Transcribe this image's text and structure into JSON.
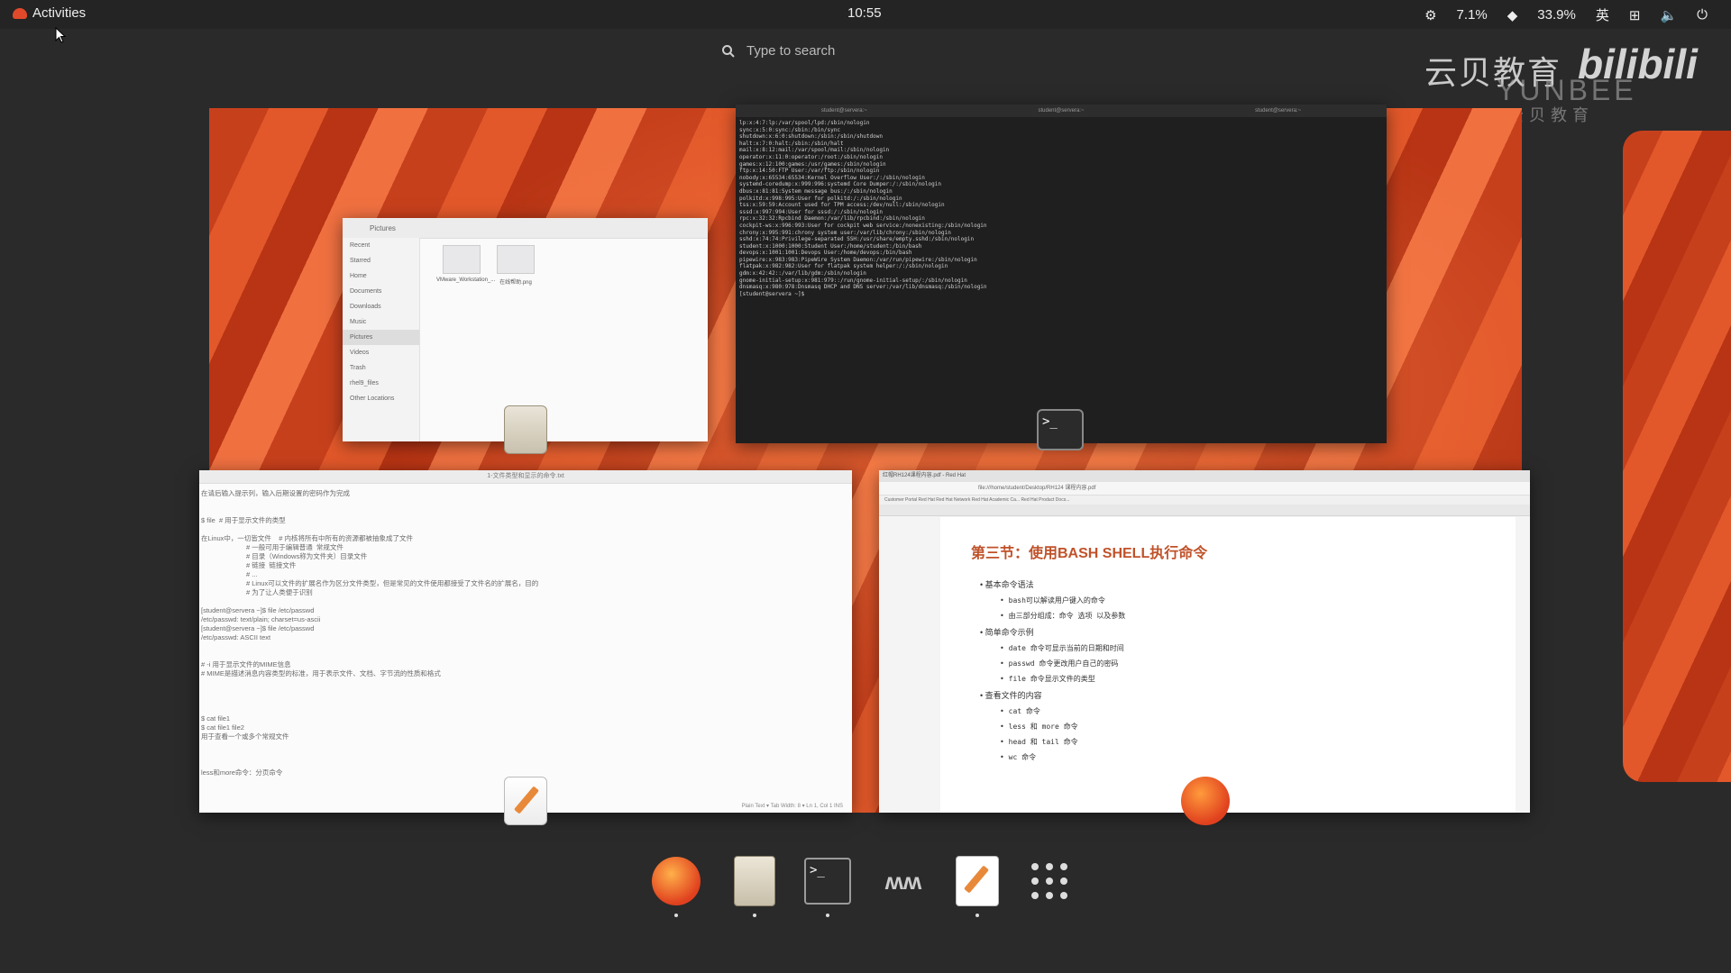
{
  "topbar": {
    "activities": "Activities",
    "clock": "10:55",
    "cpu": "7.1%",
    "mem": "33.9%",
    "input_method": "英"
  },
  "search": {
    "placeholder": "Type to search"
  },
  "watermark": {
    "cn": "云贝教育",
    "en": "YUNBEE",
    "logo": "bilibili",
    "cn2": "云贝教育"
  },
  "files_window": {
    "header": "Pictures",
    "sidebar": [
      "Recent",
      "Starred",
      "Home",
      "Documents",
      "Downloads",
      "Music",
      "Pictures",
      "Videos",
      "Trash",
      "rhel9_files",
      "Other Locations"
    ],
    "items": [
      "VMware_Workstation_...",
      "在线帮助.png"
    ]
  },
  "terminal_window": {
    "tabs": [
      "student@servera:~",
      "student@servera:~",
      "student@servera:~"
    ],
    "lines": [
      "lp:x:4:7:lp:/var/spool/lpd:/sbin/nologin",
      "sync:x:5:0:sync:/sbin:/bin/sync",
      "shutdown:x:6:0:shutdown:/sbin:/sbin/shutdown",
      "halt:x:7:0:halt:/sbin:/sbin/halt",
      "mail:x:8:12:mail:/var/spool/mail:/sbin/nologin",
      "operator:x:11:0:operator:/root:/sbin/nologin",
      "games:x:12:100:games:/usr/games:/sbin/nologin",
      "ftp:x:14:50:FTP User:/var/ftp:/sbin/nologin",
      "nobody:x:65534:65534:Kernel Overflow User:/:/sbin/nologin",
      "systemd-coredump:x:999:996:systemd Core Dumper:/:/sbin/nologin",
      "dbus:x:81:81:System message bus:/:/sbin/nologin",
      "polkitd:x:998:995:User for polkitd:/:/sbin/nologin",
      "tss:x:59:59:Account used for TPM access:/dev/null:/sbin/nologin",
      "sssd:x:997:994:User for sssd:/:/sbin/nologin",
      "rpc:x:32:32:Rpcbind Daemon:/var/lib/rpcbind:/sbin/nologin",
      "cockpit-ws:x:996:993:User for cockpit web service:/nonexisting:/sbin/nologin",
      "chrony:x:995:991:chrony system user:/var/lib/chrony:/sbin/nologin",
      "sshd:x:74:74:Privilege-separated SSH:/usr/share/empty.sshd:/sbin/nologin",
      "student:x:1000:1000:Student User:/home/student:/bin/bash",
      "devops:x:1001:1001:Devops User:/home/devops:/bin/bash",
      "pipewire:x:983:983:PipeWire System Daemon:/var/run/pipewire:/sbin/nologin",
      "flatpak:x:982:982:User for flatpak system helper:/:/sbin/nologin",
      "gdm:x:42:42::/var/lib/gdm:/sbin/nologin",
      "gnome-initial-setup:x:981:979::/run/gnome-initial-setup/:/sbin/nologin",
      "dnsmasq:x:980:978:Dnsmasq DHCP and DNS server:/var/lib/dnsmasq:/sbin/nologin",
      "[student@servera ~]$ "
    ]
  },
  "editor_window": {
    "title": "1-文件类型和显示的命令.txt",
    "lines": [
      "在请后输入提示列，输入后期设置的密码作为完成",
      "",
      "",
      "$ file  # 用于显示文件的类型",
      "",
      "在Linux中，一切皆文件    # 内核将所有中所有的资源都被抽象成了文件",
      "                        # 一般可用于编辑普通  常规文件",
      "                        # 目录（Windows称为文件夹）目录文件",
      "                        # 链接  链接文件",
      "                        # ...",
      "                        # Linux可以文件的扩展名作为区分文件类型，但是常见的文件使用都接受了文件名的扩展名，目的",
      "                        # 为了让人类便于识别",
      "",
      "[student@servera ~]$ file /etc/passwd",
      "/etc/passwd: text/plain; charset=us-ascii",
      "[student@servera ~]$ file /etc/passwd",
      "/etc/passwd: ASCII text",
      "",
      "",
      "# -i 用于显示文件的MIME信息",
      "# MIME是描述消息内容类型的标准，用于表示文件、文档、字节流的性质和格式",
      "",
      "",
      "",
      "",
      "$ cat file1",
      "$ cat file1 file2",
      "用于查看一个或多个常规文件",
      "",
      "",
      "",
      "less和more命令：分页命令"
    ],
    "status": "Plain Text ▾   Tab Width: 8 ▾   Ln 1, Col 1   INS"
  },
  "browser_window": {
    "tabs": "红帽RH124课程内容.pdf - Red Hat",
    "url": "file:///home/student/Desktop/RH124 课程内容.pdf",
    "bookmarks": "Customer Portal   Red Hat   Red Hat Network   Red Hat Academic Ca...   Red Hat Product Docs...",
    "doc": {
      "title": "第三节：使用BASH SHELL执行命令",
      "sections": [
        {
          "heading": "基本命令语法",
          "items": [
            "bash可以解读用户键入的命令",
            "由三部分组成：命令 选项 以及参数"
          ]
        },
        {
          "heading": "简单命令示例",
          "items": [
            "date 命令可显示当前的日期和时间",
            "passwd 命令更改用户自己的密码",
            "file 命令显示文件的类型"
          ]
        },
        {
          "heading": "查看文件的内容",
          "items": [
            "cat 命令",
            "less 和 more 命令",
            "head 和 tail 命令",
            "wc 命令"
          ]
        }
      ]
    }
  },
  "dash": {
    "apps": [
      "firefox-icon",
      "files-icon",
      "terminal-icon",
      "matlab-like-icon",
      "text-editor-icon",
      "app-grid-icon"
    ]
  },
  "colors": {
    "wallpaper": "#e2582a",
    "accent_doc": "#c0522a"
  }
}
